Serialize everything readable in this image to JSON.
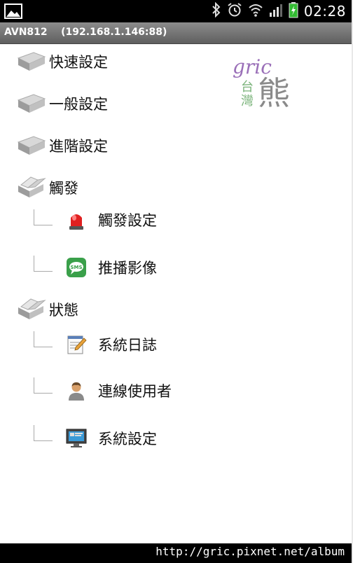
{
  "status_bar": {
    "time": "02:28",
    "icons": [
      "gallery-icon",
      "bluetooth-icon",
      "alarm-icon",
      "wifi-icon",
      "signal-icon",
      "battery-charging-icon"
    ]
  },
  "title_bar": {
    "title": "AVN812    (192.168.1.146:88)"
  },
  "menu": [
    {
      "label": "快速設定",
      "icon": "folder-closed-icon"
    },
    {
      "label": "一般設定",
      "icon": "folder-closed-icon"
    },
    {
      "label": "進階設定",
      "icon": "folder-closed-icon"
    },
    {
      "label": "觸發",
      "icon": "folder-open-icon",
      "children": [
        {
          "label": "觸發設定",
          "icon": "alarm-siren-icon"
        },
        {
          "label": "推播影像",
          "icon": "sms-icon"
        }
      ]
    },
    {
      "label": "狀態",
      "icon": "folder-open-icon",
      "children": [
        {
          "label": "系統日誌",
          "icon": "notepad-icon"
        },
        {
          "label": "連線使用者",
          "icon": "user-icon"
        },
        {
          "label": "系統設定",
          "icon": "monitor-settings-icon"
        }
      ]
    }
  ],
  "watermark": {
    "latin": "gric",
    "small": "台灣",
    "large": "熊"
  },
  "footer": {
    "url": "http://gric.pixnet.net/album"
  },
  "colors": {
    "title_bar": "#7a7a7a",
    "watermark_purple": "#9a6fb8",
    "watermark_green": "#7ab37a"
  }
}
